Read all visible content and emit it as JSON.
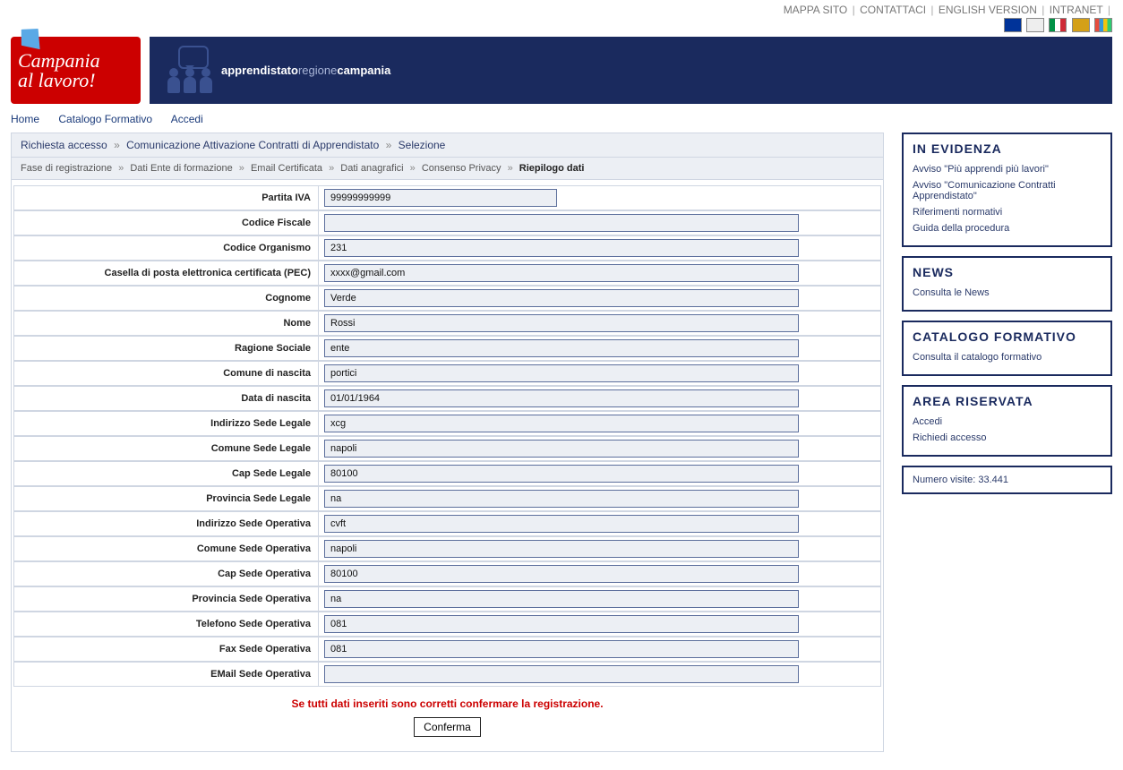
{
  "topnav": {
    "mappa": "MAPPA SITO",
    "contattaci": "CONTATTACI",
    "english": "ENGLISH VERSION",
    "intranet": "INTRANET"
  },
  "logo": {
    "line1": "Campania",
    "line2": "al lavoro!"
  },
  "banner": {
    "text_pre": "apprendistato",
    "text_mid": "regione",
    "text_post": "campania"
  },
  "nav": {
    "home": "Home",
    "catalogo": "Catalogo Formativo",
    "accedi": "Accedi"
  },
  "breadcrumb1": {
    "a": "Richiesta accesso",
    "b": "Comunicazione Attivazione Contratti di Apprendistato",
    "c": "Selezione"
  },
  "breadcrumb2": {
    "a": "Fase di registrazione",
    "b": "Dati Ente di formazione",
    "c": "Email Certificata",
    "d": "Dati anagrafici",
    "e": "Consenso Privacy",
    "f": "Riepilogo dati"
  },
  "labels": {
    "piva": "Partita IVA",
    "cf": "Codice Fiscale",
    "org": "Codice Organismo",
    "pec": "Casella di posta elettronica certificata (PEC)",
    "cognome": "Cognome",
    "nome": "Nome",
    "ragione": "Ragione Sociale",
    "com_nasc": "Comune di nascita",
    "data_nasc": "Data di nascita",
    "ind_legale": "Indirizzo Sede Legale",
    "com_legale": "Comune Sede Legale",
    "cap_legale": "Cap Sede Legale",
    "prov_legale": "Provincia Sede Legale",
    "ind_oper": "Indirizzo Sede Operativa",
    "com_oper": "Comune Sede Operativa",
    "cap_oper": "Cap Sede Operativa",
    "prov_oper": "Provincia Sede Operativa",
    "tel_oper": "Telefono Sede Operativa",
    "fax_oper": "Fax Sede Operativa",
    "email_oper": "EMail Sede Operativa"
  },
  "values": {
    "piva": "99999999999",
    "cf": "",
    "org": "231",
    "pec": "xxxx@gmail.com",
    "cognome": "Verde",
    "nome": "Rossi",
    "ragione": "ente",
    "com_nasc": "portici",
    "data_nasc": "01/01/1964",
    "ind_legale": "xcg",
    "com_legale": "napoli",
    "cap_legale": "80100",
    "prov_legale": "na",
    "ind_oper": "cvft",
    "com_oper": "napoli",
    "cap_oper": "80100",
    "prov_oper": "na",
    "tel_oper": "081",
    "fax_oper": "081",
    "email_oper": ""
  },
  "confirm_msg": "Se tutti dati inseriti sono corretti confermare la registrazione.",
  "confirm_btn": "Conferma",
  "sidebar": {
    "evidenza": {
      "title": "IN EVIDENZA",
      "items": [
        "Avviso \"Più apprendi più lavori\"",
        "Avviso \"Comunicazione Contratti Apprendistato\"",
        "Riferimenti normativi",
        "Guida della procedura"
      ]
    },
    "news": {
      "title": "NEWS",
      "items": [
        "Consulta le News"
      ]
    },
    "catalogo": {
      "title": "CATALOGO FORMATIVO",
      "items": [
        "Consulta il catalogo formativo"
      ]
    },
    "area": {
      "title": "AREA RISERVATA",
      "items": [
        "Accedi",
        "Richiedi accesso"
      ]
    },
    "visits_label": "Numero visite:",
    "visits_value": "33.441"
  }
}
